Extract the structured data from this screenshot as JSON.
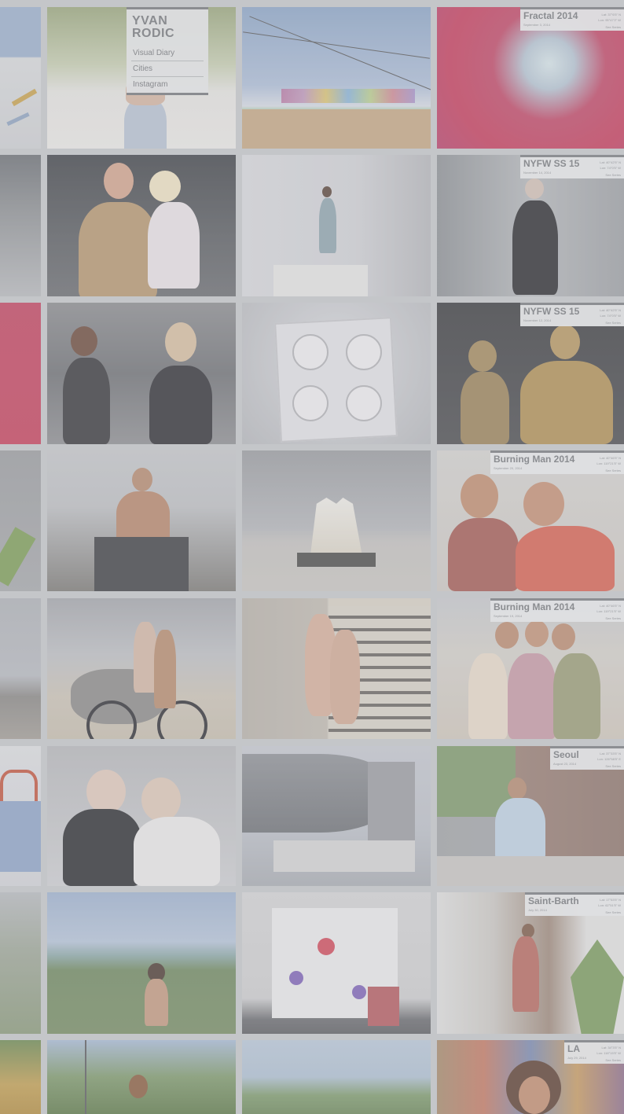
{
  "brand": {
    "title": "YVAN RODIC",
    "nav": [
      "Visual Diary",
      "Cities",
      "Instagram"
    ]
  },
  "labels": [
    {
      "title": "Fractal 2014",
      "date": "September 3, 2014",
      "lat": "Lat: 37°6'5\" N",
      "lon": "Lon: 95°47'2\" W",
      "link": "See Series"
    },
    {
      "title": "NYFW SS 15",
      "date": "November 14, 2014",
      "lat": "Lat: 40°42'5\" N",
      "lon": "Lon: 74°0'5\" W",
      "link": "See Series"
    },
    {
      "title": "NYFW SS 15",
      "date": "November 12, 2014",
      "lat": "Lat: 40°42'5\" N",
      "lon": "Lon: 74°0'5\" W",
      "link": "See Series"
    },
    {
      "title": "Burning Man 2014",
      "date": "September 20, 2014",
      "lat": "Lat: 40°46'5\" N",
      "lon": "Lon: 119°21'5\" W",
      "link": "See Series"
    },
    {
      "title": "Burning Man 2014",
      "date": "September 19, 2014",
      "lat": "Lat: 40°46'5\" N",
      "lon": "Lon: 119°21'5\" W",
      "link": "See Series"
    },
    {
      "title": "Seoul",
      "date": "August 23, 2014",
      "lat": "Lat: 37°33'5\" N",
      "lon": "Lon: 126°58'5\" E",
      "link": "See Series"
    },
    {
      "title": "Saint-Barth",
      "date": "July 30, 2014",
      "lat": "Lat: 17°53'5\" N",
      "lon": "Lon: 62°51'5\" W",
      "link": "See Series"
    },
    {
      "title": "LA",
      "date": "July 29, 2014",
      "lat": "Lat: 34°3'5\" N",
      "lon": "Lon: 118°15'5\" W",
      "link": "See Series"
    }
  ],
  "colors": {
    "background": "#c4c6c9",
    "label_text": "#8b8d91"
  }
}
